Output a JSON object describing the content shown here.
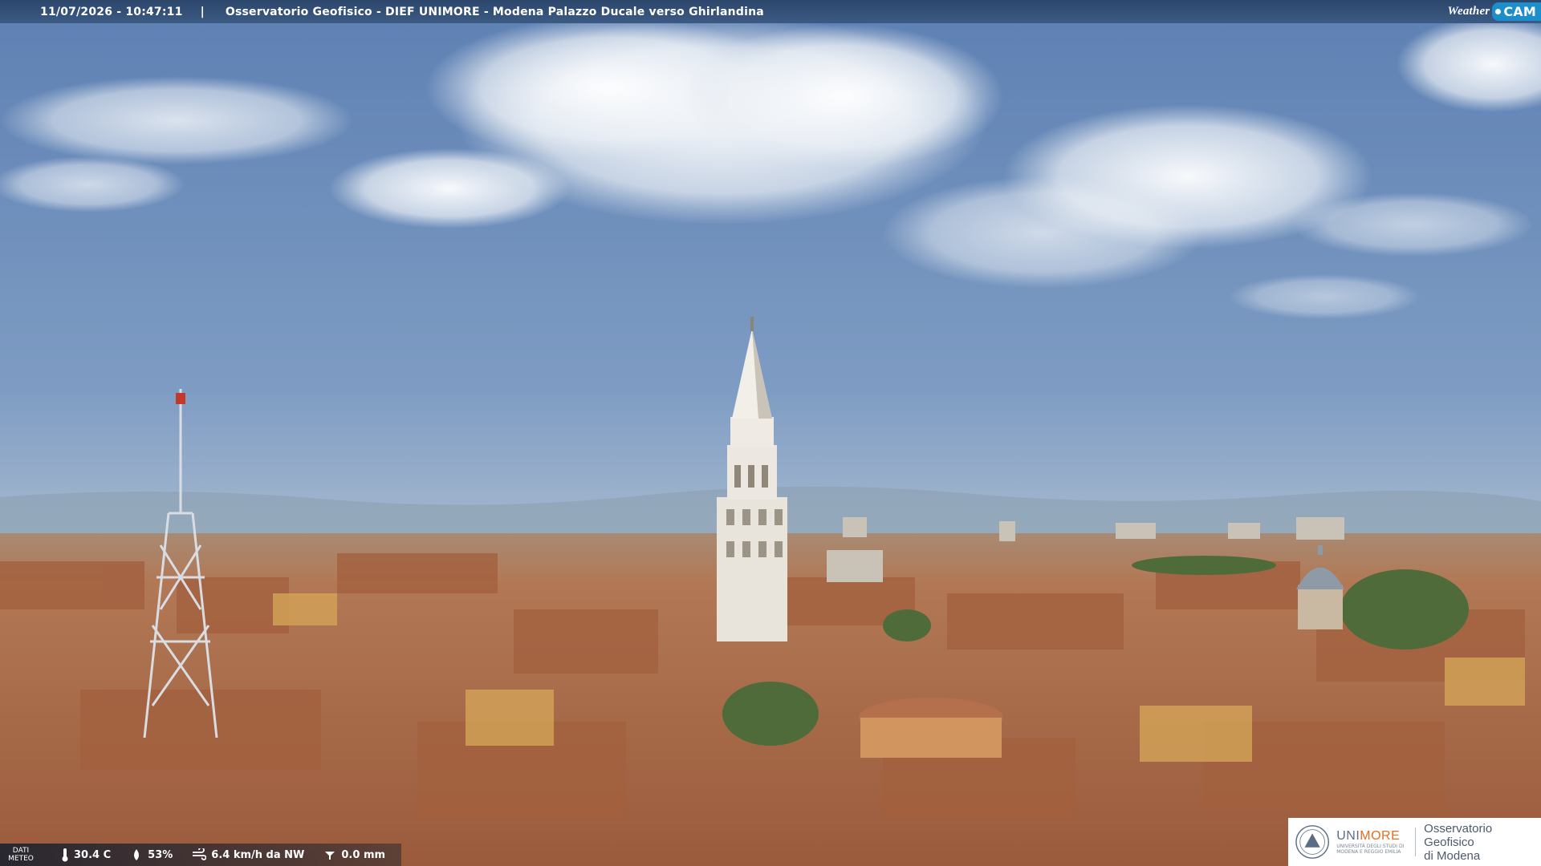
{
  "topbar": {
    "timestamp": "11/07/2026 - 10:47:11",
    "separator": "|",
    "title": "Osservatorio Geofisico - DIEF UNIMORE - Modena Palazzo Ducale verso Ghirlandina",
    "brand_weather": "Weather",
    "brand_cam": "CAM"
  },
  "weather_data": {
    "label_line1": "DATI",
    "label_line2": "METEO",
    "temperature": "30.4 C",
    "humidity": "53%",
    "wind": "6.4 km/h da NW",
    "rain": "0.0 mm",
    "icons": [
      "thermometer-icon",
      "humidity-drop-icon",
      "wind-icon",
      "rain-gauge-icon"
    ]
  },
  "logo": {
    "unimore_prefix": "UNI",
    "unimore_suffix": "MORE",
    "unimore_sub": "UNIVERSITÀ DEGLI STUDI DI MODENA E REGGIO EMILIA",
    "observatory_line1": "Osservatorio Geofisico",
    "observatory_line2": "di Modena"
  },
  "colors": {
    "sky_top": "#5f82b5",
    "sky_horizon": "#b7c6d6",
    "roofs": "#b06a45",
    "accent_orange": "#e46d1e",
    "bar_bg": "#2c466b"
  }
}
